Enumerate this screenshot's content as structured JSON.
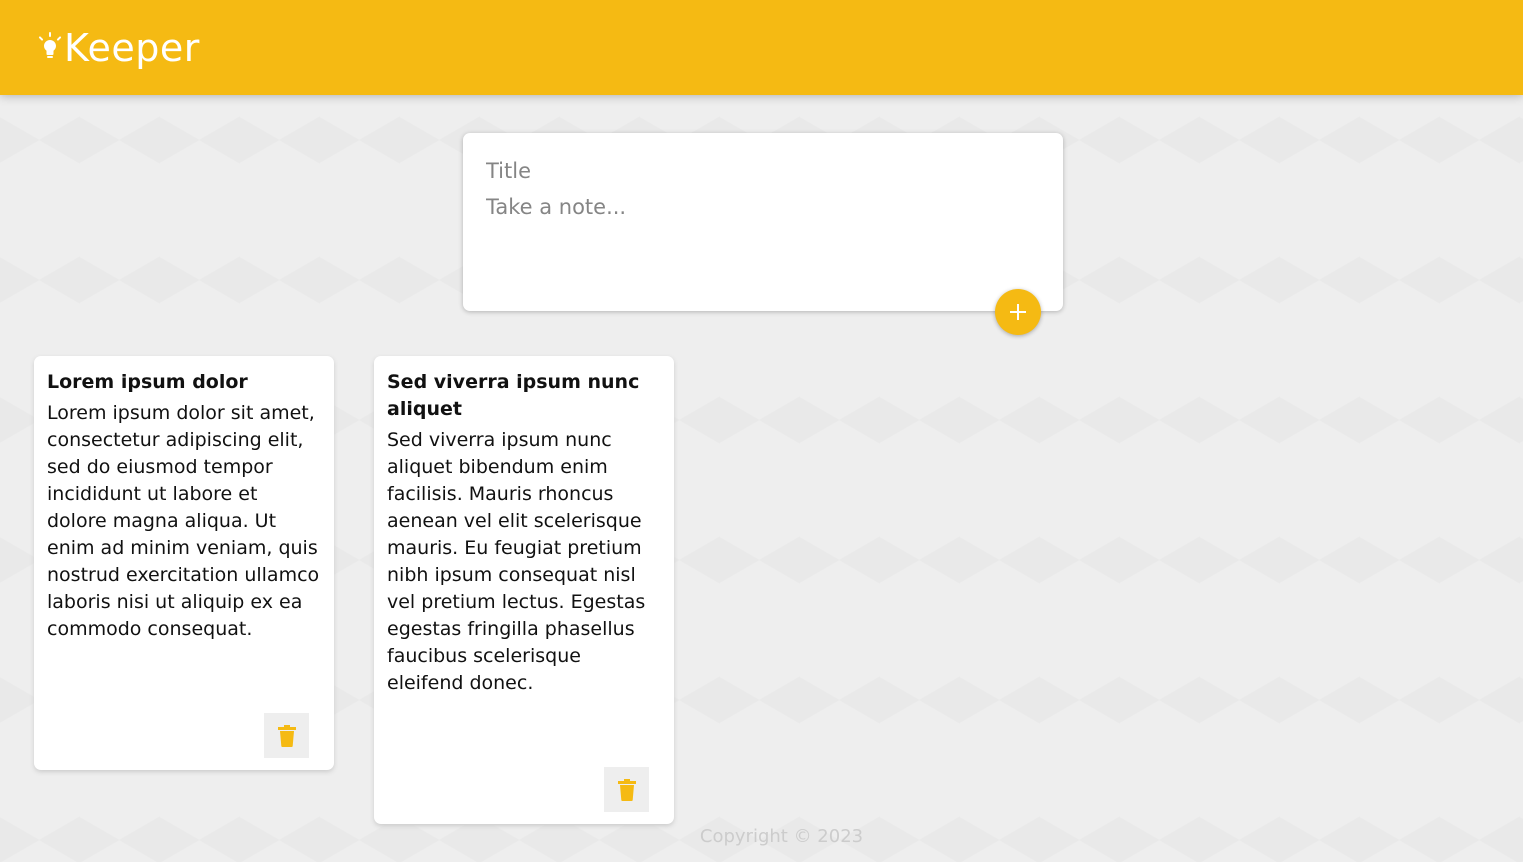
{
  "header": {
    "app_name": "Keeper",
    "logo_icon": "lightbulb-icon"
  },
  "create_note": {
    "title_placeholder": "Title",
    "content_placeholder": "Take a note...",
    "add_icon": "plus-icon"
  },
  "notes": [
    {
      "title": "Lorem ipsum dolor",
      "content": "Lorem ipsum dolor sit amet, consectetur adipiscing elit, sed do eiusmod tempor incididunt ut labore et dolore magna aliqua. Ut enim ad minim veniam, quis nostrud exercitation ullamco laboris nisi ut aliquip ex ea commodo consequat.",
      "delete_icon": "trash-icon"
    },
    {
      "title": "Sed viverra ipsum nunc aliquet",
      "content": "Sed viverra ipsum nunc aliquet bibendum enim facilisis. Mauris rhoncus aenean vel elit scelerisque mauris. Eu feugiat pretium nibh ipsum consequat nisl vel pretium lectus. Egestas egestas fringilla phasellus faucibus scelerisque eleifend donec.",
      "delete_icon": "trash-icon"
    }
  ],
  "footer": {
    "copyright": "Copyright © 2023"
  },
  "colors": {
    "accent": "#f5ba13",
    "background": "#eeeeee"
  }
}
